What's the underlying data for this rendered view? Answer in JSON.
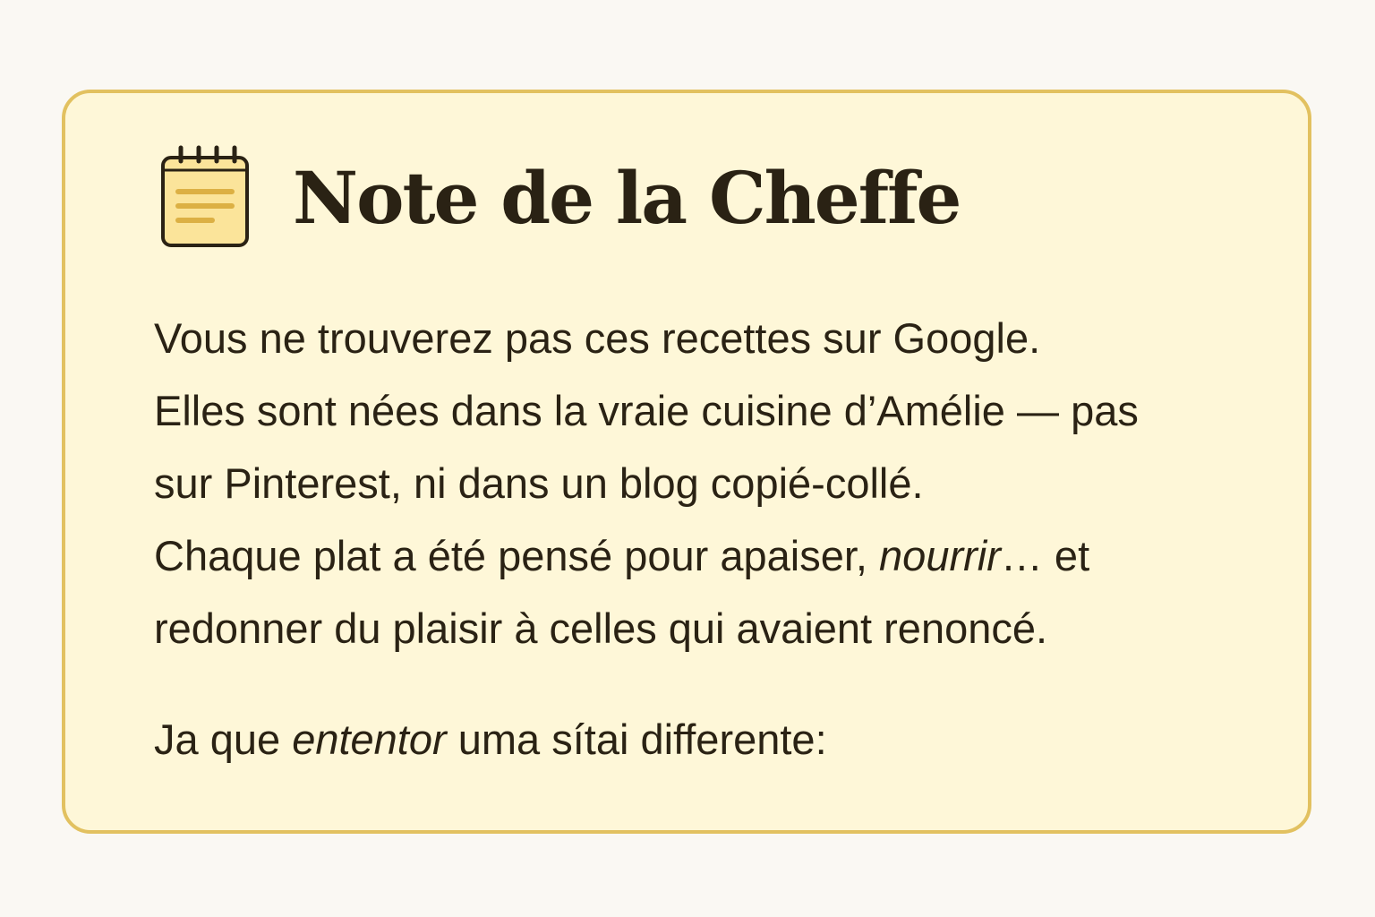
{
  "card": {
    "title": "Note de la Cheffe",
    "icon": "notepad-icon",
    "lines": [
      {
        "text": "Vous ne trouverez pas ces recettes sur Google."
      },
      {
        "text": "Elles sont nées dans la vraie cuisine d’Amélie — pas"
      },
      {
        "text": "sur Pinterest, ni dans un blog copié-collé."
      },
      {
        "before": "Chaque plat a été pensé pour apaiser, ",
        "emphasis": "nourrir",
        "after": "… et"
      },
      {
        "text": "redonner du plaisir à celles qui avaient renoncé."
      }
    ],
    "footer": {
      "before": "Ja que ",
      "emphasis": "ententor",
      "after": " uma sítai differente:"
    }
  },
  "colors": {
    "background": "#faf8f3",
    "card_fill": "#fef7d8",
    "card_border": "#e2c160",
    "text": "#2a2214"
  }
}
